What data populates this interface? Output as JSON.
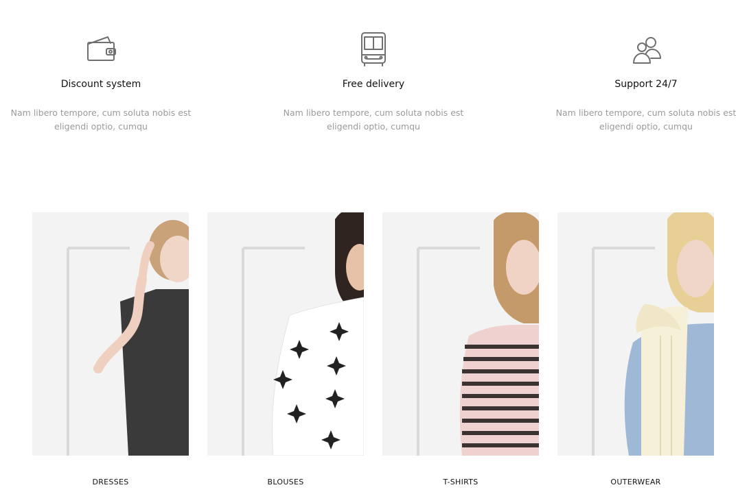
{
  "features": [
    {
      "icon": "wallet-icon",
      "title": "Discount system",
      "desc_line1": "Nam libero tempore, cum soluta nobis est",
      "desc_line2": "eligendi optio, cumqu"
    },
    {
      "icon": "bus-icon",
      "title": "Free delivery",
      "desc_line1": "Nam libero tempore, cum soluta nobis est",
      "desc_line2": "eligendi optio, cumqu"
    },
    {
      "icon": "users-icon",
      "title": "Support 24/7",
      "desc_line1": "Nam libero tempore, cum soluta nobis est",
      "desc_line2": "eligendi optio, cumqu"
    }
  ],
  "categories": [
    {
      "label": "DRESSES",
      "image": "woman-dark-dress"
    },
    {
      "label": "BLOUSES",
      "image": "woman-white-blouse"
    },
    {
      "label": "T-SHIRTS",
      "image": "woman-striped-shirt"
    },
    {
      "label": "OUTERWEAR",
      "image": "woman-puffer-vest"
    }
  ],
  "colors": {
    "text": "#111111",
    "muted": "#9a9a9a",
    "icon": "#6f6f6f",
    "image_bg": "#f2f2f2"
  }
}
